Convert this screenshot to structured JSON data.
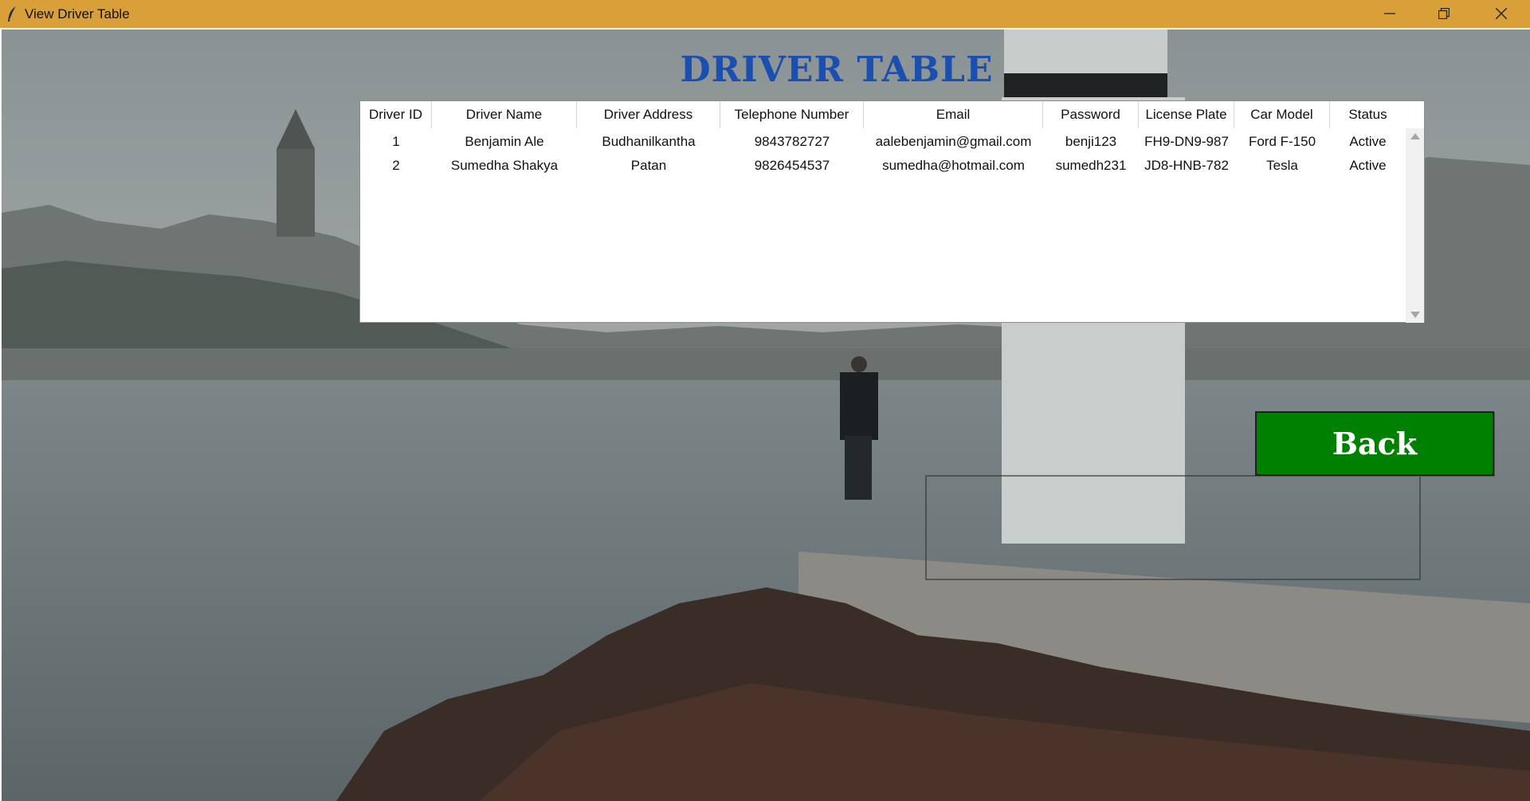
{
  "window": {
    "title": "View Driver Table",
    "icon": "feather-icon",
    "controls": [
      "minimize-icon",
      "maximize-icon",
      "close-icon"
    ],
    "titlebar_color": "#d9a03a"
  },
  "heading": "DRIVER TABLE",
  "table": {
    "columns": [
      "Driver ID",
      "Driver Name",
      "Driver Address",
      "Telephone Number",
      "Email",
      "Password",
      "License Plate",
      "Car Model",
      "Status"
    ],
    "rows": [
      [
        "1",
        "Benjamin Ale",
        "Budhanilkantha",
        "9843782727",
        "aalebenjamin@gmail.com",
        "benji123",
        "FH9-DN9-987",
        "Ford F-150",
        "Active"
      ],
      [
        "2",
        "Sumedha Shakya",
        "Patan",
        "9826454537",
        "sumedha@hotmail.com",
        "sumedh231",
        "JD8-HNB-782",
        "Tesla",
        "Active"
      ]
    ]
  },
  "back_button": {
    "label": "Back",
    "color": "#008000"
  },
  "colors": {
    "heading": "#1a4fb0"
  }
}
